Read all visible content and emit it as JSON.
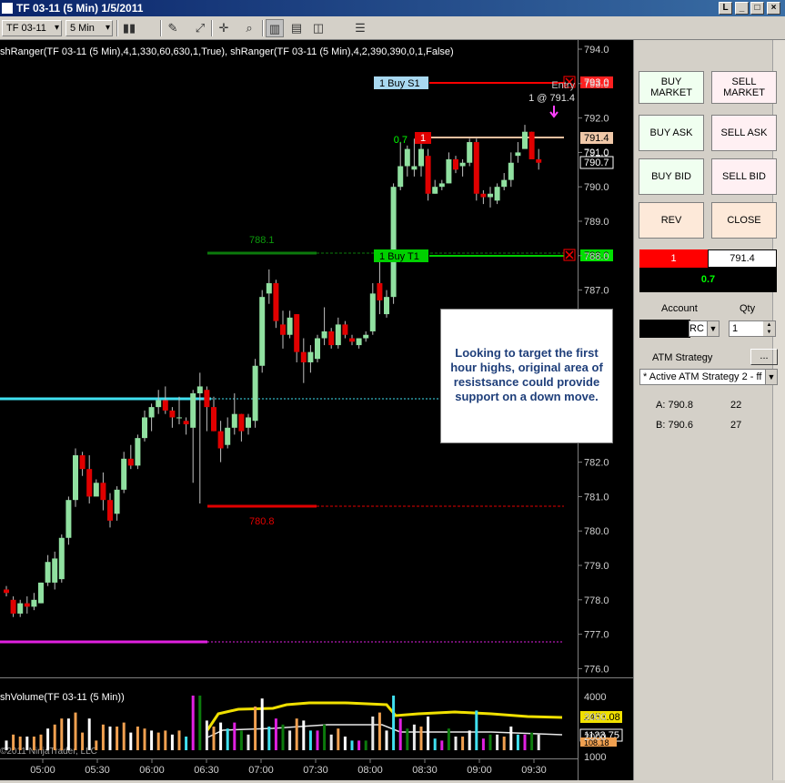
{
  "window": {
    "title": "TF 03-11 (5 Min)  1/5/2011",
    "btn_l": "L",
    "btn_min": "_",
    "btn_max": "□",
    "btn_close": "×"
  },
  "toolbar": {
    "instrument": "TF 03-11",
    "period": "5 Min"
  },
  "indicator": {
    "label": "shRanger(TF 03-11 (5 Min),4,1,330,60,630,1,True), shRanger(TF 03-11 (5 Min),4,2,390,390,0,1,False)",
    "volume_label": "shVolume(TF 03-11 (5 Min))",
    "copyright": "©2011 NinjaTrader, LLC"
  },
  "orders": {
    "s1_label": "1  Buy S1",
    "t1_label": "1  Buy T1",
    "entry_label": "Entry",
    "entry_fill": "1 @ 791.4",
    "pos_qty": "1",
    "pos_pnl": "0.7"
  },
  "levels": {
    "high_label": "788.1",
    "low_label": "780.8"
  },
  "tags": {
    "s1_price": "793.0",
    "t1_price": "788.0",
    "entry_price": "791.4",
    "last_price": "790.7",
    "bid_tag": "791.0",
    "vol_yellow": "2453.08",
    "vol_white": "1123.75",
    "vol_low": "108.18"
  },
  "note": "Looking to target the first hour highs, original area of resistsance could provide support on a down move.",
  "axis": {
    "price_ticks": [
      "794.0",
      "793.0",
      "792.0",
      "791.0",
      "790.0",
      "789.0",
      "788.0",
      "787.0",
      "786.0",
      "785.0",
      "784.0",
      "783.0",
      "782.0",
      "781.0",
      "780.0",
      "779.0",
      "778.0",
      "777.0",
      "776.0"
    ],
    "vol_ticks": [
      "4000",
      "3000",
      "2000",
      "1000"
    ],
    "time_ticks": [
      "05:00",
      "05:30",
      "06:00",
      "06:30",
      "07:00",
      "07:30",
      "08:00",
      "08:30",
      "09:00",
      "09:30"
    ]
  },
  "panel": {
    "buy_market": "BUY MARKET",
    "sell_market": "SELL MARKET",
    "buy_ask": "BUY ASK",
    "sell_ask": "SELL ASK",
    "buy_bid": "BUY BID",
    "sell_bid": "SELL BID",
    "rev": "REV",
    "close": "CLOSE",
    "pos_qty": "1",
    "price": "791.4",
    "pnl": "0.7",
    "account_label": "Account",
    "qty_label": "Qty",
    "account_suffix": "RC",
    "qty_value": "1",
    "atm_label": "ATM Strategy",
    "atm_btn": "...",
    "atm_value": "* Active ATM Strategy 2 - ff",
    "ask_label": "A: 790.8",
    "ask_size": "22",
    "bid_label": "B: 790.6",
    "bid_size": "27"
  },
  "colors": {
    "up": "#90e0a0",
    "down": "#e00000",
    "cyan": "#40e0f0",
    "magenta": "#e020e0",
    "red_line": "#ff0000",
    "green_line": "#00d000",
    "darkgreen": "#0c7a0c",
    "yellow": "#f0e000"
  },
  "chart_data": {
    "type": "candlestick",
    "ylim": [
      775.7,
      794.2
    ],
    "candles": [
      [
        778.3,
        778.4,
        778.1,
        778.2
      ],
      [
        778.0,
        778.1,
        777.5,
        777.6
      ],
      [
        777.6,
        778.0,
        777.5,
        777.9
      ],
      [
        777.9,
        778.1,
        777.6,
        777.8
      ],
      [
        777.8,
        778.2,
        777.7,
        778.0
      ],
      [
        777.9,
        778.5,
        777.9,
        778.5
      ],
      [
        778.5,
        779.3,
        778.4,
        779.1
      ],
      [
        778.5,
        779.4,
        778.3,
        779.2
      ],
      [
        778.6,
        779.9,
        778.5,
        779.8
      ],
      [
        779.8,
        781.0,
        779.6,
        780.9
      ],
      [
        780.9,
        782.4,
        780.7,
        782.2
      ],
      [
        782.2,
        782.3,
        781.6,
        781.8
      ],
      [
        781.8,
        782.2,
        780.8,
        781.0
      ],
      [
        781.0,
        781.5,
        781.2,
        781.4
      ],
      [
        781.4,
        781.7,
        780.6,
        780.9
      ],
      [
        780.9,
        781.1,
        780.1,
        780.3
      ],
      [
        780.5,
        781.3,
        780.3,
        781.2
      ],
      [
        781.2,
        782.3,
        781.1,
        782.1
      ],
      [
        782.1,
        782.5,
        781.8,
        781.9
      ],
      [
        781.9,
        782.8,
        781.8,
        782.7
      ],
      [
        782.7,
        783.5,
        782.6,
        783.3
      ],
      [
        783.3,
        783.7,
        782.9,
        783.6
      ],
      [
        783.6,
        784.1,
        783.4,
        783.8
      ],
      [
        783.8,
        784.2,
        783.4,
        783.5
      ],
      [
        783.5,
        783.6,
        783.0,
        783.3
      ],
      [
        783.3,
        783.9,
        783.1,
        783.3
      ],
      [
        783.2,
        783.3,
        782.8,
        783.1
      ],
      [
        783.0,
        784.1,
        781.4,
        784.0
      ],
      [
        784.0,
        784.6,
        780.8,
        784.2
      ],
      [
        784.1,
        784.2,
        782.9,
        783.6
      ],
      [
        783.6,
        783.9,
        782.9,
        782.9
      ],
      [
        782.9,
        783.2,
        782.0,
        782.4
      ],
      [
        782.5,
        783.3,
        782.4,
        783.0
      ],
      [
        783.0,
        784.0,
        782.8,
        783.4
      ],
      [
        783.4,
        783.4,
        782.6,
        782.9
      ],
      [
        783.0,
        783.4,
        782.8,
        783.3
      ],
      [
        783.2,
        785.0,
        783.0,
        784.8
      ],
      [
        784.8,
        787.0,
        784.6,
        786.8
      ],
      [
        786.9,
        787.6,
        786.6,
        787.2
      ],
      [
        787.2,
        787.3,
        785.9,
        786.1
      ],
      [
        786.0,
        786.4,
        785.3,
        785.7
      ],
      [
        785.7,
        786.4,
        785.6,
        786.2
      ],
      [
        786.3,
        786.3,
        784.9,
        785.2
      ],
      [
        785.2,
        785.6,
        784.3,
        784.9
      ],
      [
        784.9,
        785.4,
        784.6,
        785.2
      ],
      [
        785.0,
        785.7,
        784.9,
        785.6
      ],
      [
        785.6,
        786.5,
        785.4,
        785.8
      ],
      [
        785.8,
        785.9,
        785.3,
        785.4
      ],
      [
        785.4,
        786.2,
        785.3,
        786.0
      ],
      [
        786.0,
        786.1,
        785.6,
        785.7
      ],
      [
        785.6,
        785.7,
        785.4,
        785.5
      ],
      [
        785.4,
        785.6,
        785.3,
        785.6
      ],
      [
        785.6,
        785.8,
        785.5,
        785.7
      ],
      [
        785.8,
        787.2,
        785.7,
        786.9
      ],
      [
        787.2,
        788.0,
        786.3,
        786.7
      ],
      [
        786.3,
        787.0,
        786.2,
        786.8
      ],
      [
        786.8,
        790.1,
        786.6,
        790.0
      ],
      [
        790.0,
        791.3,
        789.9,
        790.6
      ],
      [
        790.6,
        791.2,
        790.3,
        791.1
      ],
      [
        790.5,
        791.4,
        790.3,
        790.6
      ],
      [
        790.6,
        791.3,
        790.3,
        791.1
      ],
      [
        790.9,
        791.1,
        789.6,
        789.8
      ],
      [
        789.8,
        790.2,
        789.8,
        790.0
      ],
      [
        790.0,
        790.2,
        789.9,
        790.1
      ],
      [
        790.1,
        791.0,
        790.1,
        790.8
      ],
      [
        790.8,
        790.9,
        790.4,
        790.5
      ],
      [
        790.6,
        790.8,
        790.3,
        790.7
      ],
      [
        790.7,
        791.4,
        790.6,
        791.3
      ],
      [
        791.3,
        791.4,
        789.6,
        789.8
      ],
      [
        789.8,
        789.9,
        789.5,
        789.7
      ],
      [
        789.7,
        790.0,
        789.4,
        789.8
      ],
      [
        789.6,
        790.1,
        789.5,
        790.0
      ],
      [
        790.0,
        790.4,
        789.9,
        790.2
      ],
      [
        790.2,
        791.0,
        790.0,
        790.7
      ],
      [
        790.9,
        791.3,
        790.7,
        791.0
      ],
      [
        791.1,
        791.8,
        791.2,
        791.6
      ],
      [
        791.6,
        791.6,
        790.9,
        790.8
      ],
      [
        790.8,
        791.1,
        790.5,
        790.7
      ]
    ],
    "volume_labels": {
      "yellow": "2453.08",
      "white": "1123.75"
    }
  }
}
